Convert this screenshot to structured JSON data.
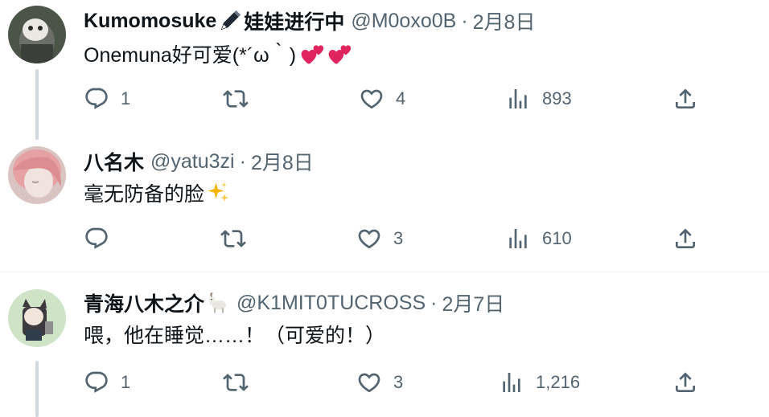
{
  "replies": [
    {
      "name": "Kumomosuke",
      "name_suffix": "娃娃进行中",
      "handle": "@M0oxo0B",
      "separator": "·",
      "date": "2月8日",
      "text": "Onemuna好可爱(*´ω｀)",
      "emoji": [
        "two-hearts",
        "two-hearts"
      ],
      "replies_count": "1",
      "retweets_count": "",
      "likes_count": "4",
      "views_count": "893"
    },
    {
      "name": "八名木",
      "handle": "@yatu3zi",
      "separator": "·",
      "date": "2月8日",
      "text": "毫无防备的脸",
      "emoji": [
        "sparkles"
      ],
      "replies_count": "",
      "retweets_count": "",
      "likes_count": "3",
      "views_count": "610"
    },
    {
      "name": "青海八木之介",
      "handle": "@K1MIT0TUCROSS",
      "separator": "·",
      "date": "2月7日",
      "text": "喂，他在睡觉……！（可爱的！）",
      "emoji": [
        "goat"
      ],
      "replies_count": "1",
      "retweets_count": "",
      "likes_count": "3",
      "views_count": "1,216"
    }
  ],
  "colors": {
    "text_primary": "#0f1419",
    "text_secondary": "#536471",
    "thread_line": "#cfd9de",
    "divider": "#eff3f4",
    "heart_emoji": "#e0245e"
  }
}
